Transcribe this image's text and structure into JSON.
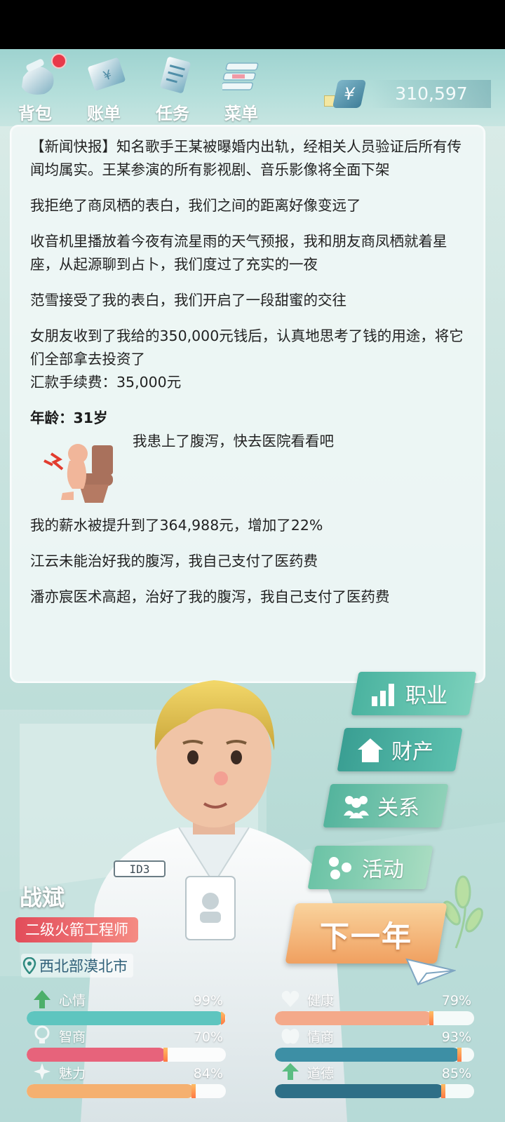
{
  "toolbar": {
    "items": [
      {
        "label": "背包",
        "icon": "backpack-icon"
      },
      {
        "label": "账单",
        "icon": "bill-icon"
      },
      {
        "label": "任务",
        "icon": "task-icon"
      },
      {
        "label": "菜单",
        "icon": "menu-icon"
      }
    ],
    "money": {
      "symbol": "¥",
      "value": "310,597"
    }
  },
  "log": {
    "entries": [
      "【新闻快报】知名歌手王某被曝婚内出轨，经相关人员验证后所有传闻均属实。王某参演的所有影视剧、音乐影像将全面下架",
      "我拒绝了商凤栖的表白，我们之间的距离好像变远了",
      "收音机里播放着今夜有流星雨的天气预报，我和朋友商凤栖就着星座，从起源聊到占卜，我们度过了充实的一夜",
      "范雪接受了我的表白，我们开启了一段甜蜜的交往"
    ],
    "gift_entry": "女朋友收到了我给的350,000元钱后，认真地思考了钱的用途，将它们全部拿去投资了",
    "gift_fee": "汇款手续费：35,000元",
    "age": "年龄：31岁",
    "illness": "我患上了腹泻，快去医院看看吧",
    "after": [
      "我的薪水被提升到了364,988元，增加了22%",
      "江云未能治好我的腹泻，我自己支付了医药费",
      "潘亦宸医术高超，治好了我的腹泻，我自己支付了医药费"
    ]
  },
  "actions": {
    "career": "职业",
    "property": "财产",
    "relations": "关系",
    "activities": "活动",
    "next_year": "下一年"
  },
  "player": {
    "name": "战斌",
    "job": "二级火箭工程师",
    "location": "西北部漠北市",
    "badge": "ID3"
  },
  "stats": [
    {
      "name": "心情",
      "pct": "99%",
      "value": 0.99,
      "color": "#5ec5bf"
    },
    {
      "name": "健康",
      "pct": "79%",
      "value": 0.79,
      "color": "#f4a98a"
    },
    {
      "name": "智商",
      "pct": "70%",
      "value": 0.7,
      "color": "#e7637b"
    },
    {
      "name": "情商",
      "pct": "93%",
      "value": 0.93,
      "color": "#3d8fa5"
    },
    {
      "name": "魅力",
      "pct": "84%",
      "value": 0.84,
      "color": "#f5b070"
    },
    {
      "name": "道德",
      "pct": "85%",
      "value": 0.85,
      "color": "#2e6f87"
    }
  ]
}
